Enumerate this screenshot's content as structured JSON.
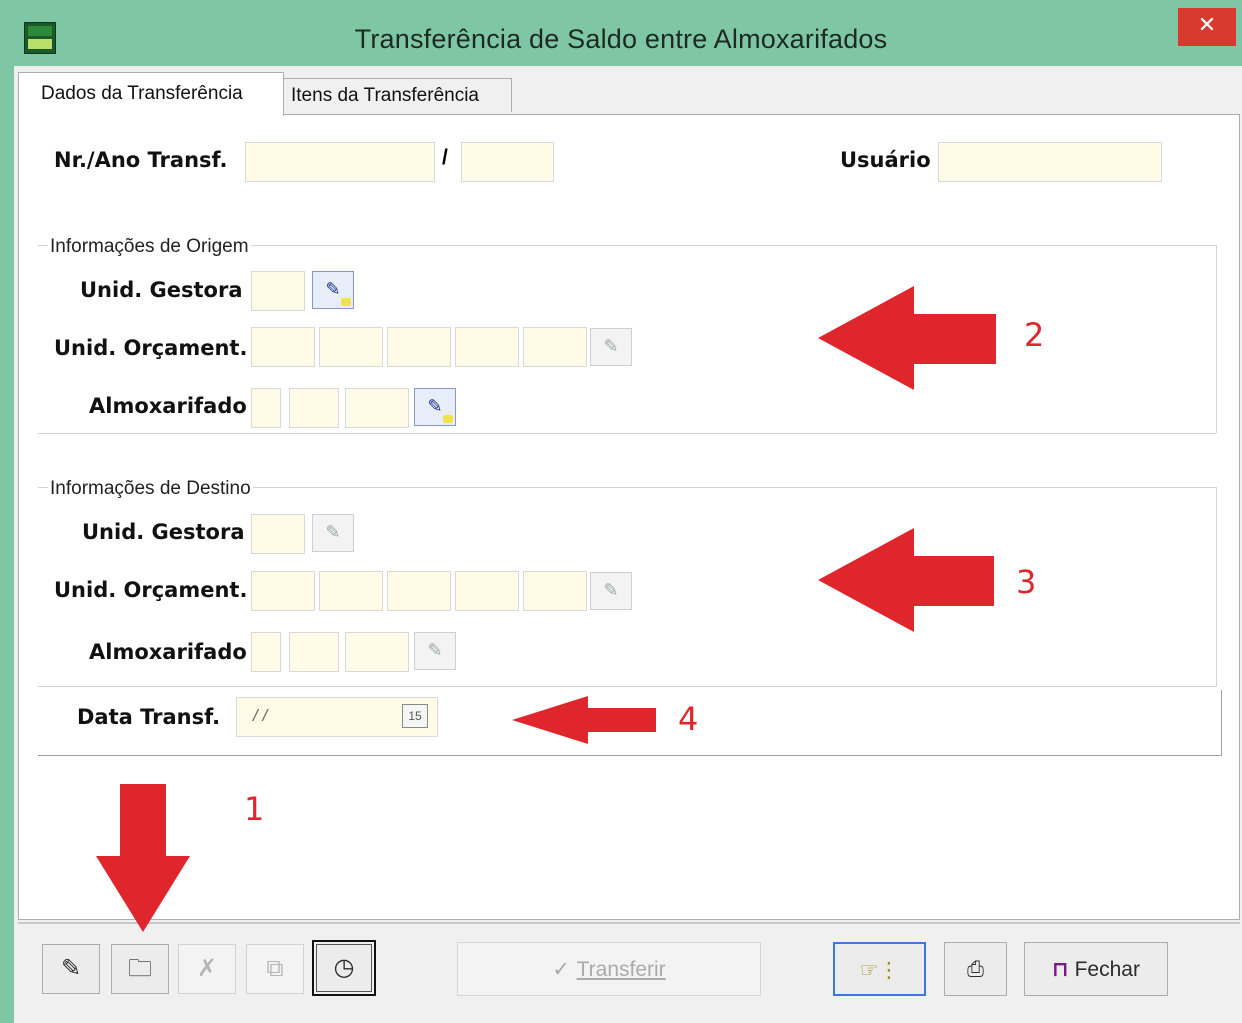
{
  "window": {
    "title": "Transferência de Saldo entre Almoxarifados",
    "close_label": "✕"
  },
  "tabs": [
    {
      "label": "Dados da Transferência",
      "active": true
    },
    {
      "label": "Itens da Transferência",
      "active": false
    }
  ],
  "header": {
    "nr_ano_label": "Nr./Ano Transf.",
    "separator": "/",
    "usuario_label": "Usuário"
  },
  "origem": {
    "group_title": "Informações de Origem",
    "unid_gestora_label": "Unid. Gestora",
    "unid_orcament_label": "Unid. Orçament.",
    "almoxarifado_label": "Almoxarifado"
  },
  "destino": {
    "group_title": "Informações de Destino",
    "unid_gestora_label": "Unid. Gestora",
    "unid_orcament_label": "Unid. Orçament.",
    "almoxarifado_label": "Almoxarifado"
  },
  "data_transf": {
    "label": "Data Transf.",
    "value": " / /",
    "calendar_glyph": "15"
  },
  "annotations": {
    "n1": "1",
    "n2": "2",
    "n3": "3",
    "n4": "4",
    "color": "#e0262d"
  },
  "toolbar": {
    "transferir_label": "Transferir",
    "fechar_label": "Fechar"
  },
  "colors": {
    "title_bar": "#7fc6a4",
    "field_bg": "#fffbe6",
    "close_button": "#d93a2e"
  }
}
